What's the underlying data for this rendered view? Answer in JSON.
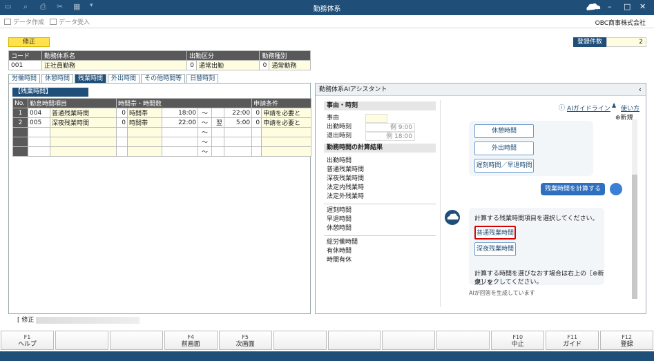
{
  "window": {
    "title": "勤務体系",
    "company": "OBC商事株式会社"
  },
  "toolbar": {
    "create_data": "データ作成",
    "import_data": "データ受入"
  },
  "mode": "修正",
  "record_count": {
    "label": "登録件数",
    "value": "2"
  },
  "header_table": {
    "cols": [
      "コード",
      "勤務体系名",
      "出勤区分",
      "勤務種別"
    ],
    "code": "001",
    "name": "正社員勤務",
    "attend_no": "0",
    "attend_val": "通常出勤",
    "kind_no": "0",
    "kind_val": "通常勤務"
  },
  "tabs": [
    "労働時間",
    "休憩時間",
    "残業時間",
    "外出時間",
    "その他時間等",
    "日替時刻"
  ],
  "section_title": "【残業時間】",
  "grid": {
    "cols": [
      "No.",
      "勤怠時間項目",
      "時間帯・時間数",
      "申請条件"
    ],
    "rows": [
      {
        "no": "1",
        "code": "004",
        "name": "普通残業時間",
        "f": "0",
        "type": "時間帯",
        "from": "18:00",
        "tilde": "～",
        "next": "",
        "to": "22:00",
        "c": "0",
        "cond": "申請を必要と"
      },
      {
        "no": "2",
        "code": "005",
        "name": "深夜残業時間",
        "f": "0",
        "type": "時間帯",
        "from": "22:00",
        "tilde": "～",
        "next": "翌",
        "to": "5:00",
        "c": "0",
        "cond": "申請を必要と"
      },
      {
        "no": "",
        "code": "",
        "name": "",
        "f": "",
        "type": "",
        "from": "",
        "tilde": "～",
        "next": "",
        "to": "",
        "c": "",
        "cond": ""
      },
      {
        "no": "",
        "code": "",
        "name": "",
        "f": "",
        "type": "",
        "from": "",
        "tilde": "～",
        "next": "",
        "to": "",
        "c": "",
        "cond": ""
      },
      {
        "no": "",
        "code": "",
        "name": "",
        "f": "",
        "type": "",
        "from": "",
        "tilde": "～",
        "next": "",
        "to": "",
        "c": "",
        "cond": ""
      }
    ]
  },
  "status_left": "[ 修正",
  "ai": {
    "title": "勤務体系AIアシスタント",
    "guide_link": "AIガイドライン",
    "howto_link": "使い方",
    "new_label": "新規",
    "event_head": "事由・時刻",
    "event_rows": [
      {
        "label": "事由",
        "value": ""
      },
      {
        "label": "出勤時刻",
        "value": "例 9:00"
      },
      {
        "label": "退出時刻",
        "value": "例 18:00"
      }
    ],
    "result_head": "勤務時間の計算結果",
    "result_group1": [
      "出勤時間",
      "普通残業時間",
      "深夜残業時間",
      "法定内残業時",
      "法定外残業時"
    ],
    "result_group2": [
      "遅刻時間",
      "早退時間",
      "休憩時間"
    ],
    "result_group3": [
      "総労働時間",
      "有休時間",
      "時間有休"
    ],
    "prev_choices": [
      "休憩時間",
      "外出時間",
      "遅刻時間／早退時間"
    ],
    "user_msg": "残業時間を計算する",
    "bot_msg": "計算する残業時間項目を選択してください。",
    "choices": [
      "普通残業時間",
      "深夜残業時間"
    ],
    "bot_note": "計算する時間を選びなおす場合は右上の［⊕新規］を",
    "bot_note2": "クリックしてください。",
    "generating": "AIが回答を生成しています"
  },
  "fkeys": [
    {
      "key": "F1",
      "label": "ヘルプ"
    },
    {
      "key": "",
      "label": ""
    },
    {
      "key": "",
      "label": ""
    },
    {
      "key": "F4",
      "label": "前画面"
    },
    {
      "key": "F5",
      "label": "次画面"
    },
    {
      "key": "",
      "label": ""
    },
    {
      "key": "",
      "label": ""
    },
    {
      "key": "",
      "label": ""
    },
    {
      "key": "",
      "label": ""
    },
    {
      "key": "F10",
      "label": "中止"
    },
    {
      "key": "F11",
      "label": "ガイド"
    },
    {
      "key": "F12",
      "label": "登録"
    }
  ]
}
